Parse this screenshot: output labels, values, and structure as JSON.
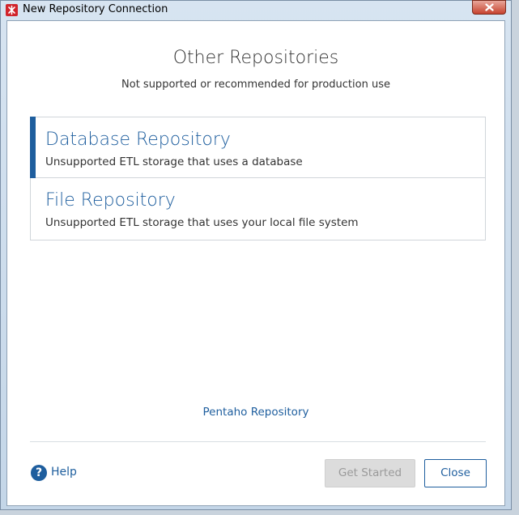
{
  "window": {
    "title": "New Repository Connection"
  },
  "header": {
    "title": "Other Repositories",
    "subtitle": "Not supported or recommended for production use"
  },
  "repositories": [
    {
      "name": "Database Repository",
      "description": "Unsupported ETL storage that uses a database",
      "selected": true
    },
    {
      "name": "File Repository",
      "description": "Unsupported ETL storage that uses your local file system",
      "selected": false
    }
  ],
  "links": {
    "pentaho": "Pentaho Repository"
  },
  "footer": {
    "help_label": "Help",
    "help_glyph": "?",
    "get_started_label": "Get Started",
    "close_label": "Close"
  },
  "colors": {
    "accent": "#1e5e9e",
    "disabled_button": "#dcdcdc",
    "titlebar_close": "#c7432e"
  }
}
